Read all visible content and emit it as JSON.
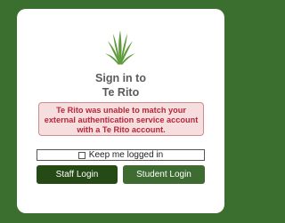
{
  "login": {
    "heading_line1": "Sign in to",
    "heading_line2": "Te Rito",
    "error_message": "Te Rito was unable to match your external authentication service account with a Te Rito account.",
    "keep_logged_in_label": "Keep me logged in",
    "keep_logged_in_checked": false,
    "staff_button_label": "Staff Login",
    "student_button_label": "Student Login"
  },
  "colors": {
    "background": "#3b6f2f",
    "card": "#ffffff",
    "error_bg": "#f7dede",
    "error_border": "#d28a8a",
    "error_text": "#b5283a",
    "staff_button": "#264a16",
    "student_button": "#3d6b31",
    "heading_text": "#5a5a5a"
  },
  "icons": {
    "logo": "flax-plant-logo-icon",
    "checkbox": "checkbox-unchecked-icon"
  }
}
